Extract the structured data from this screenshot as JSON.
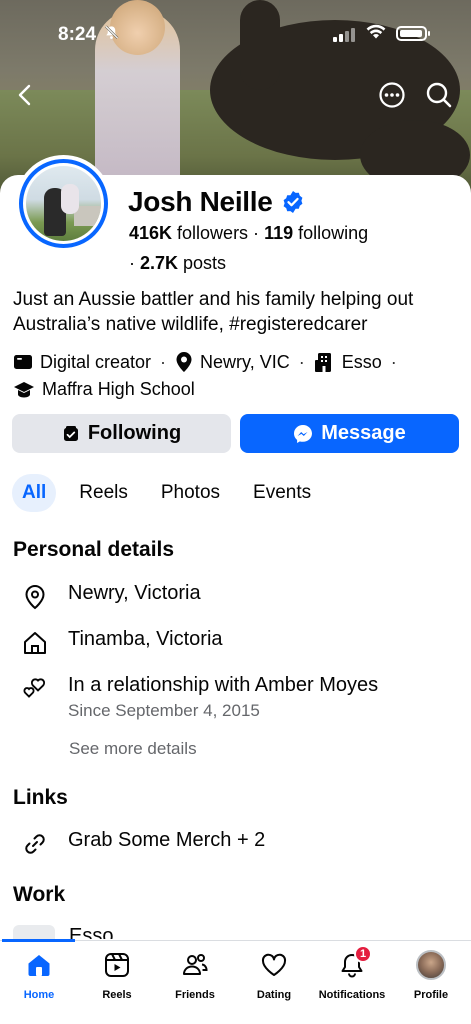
{
  "status_bar": {
    "time": "8:24"
  },
  "profile": {
    "name": "Josh Neille",
    "followers_count": "416K",
    "followers_label": " followers · ",
    "following_count": "119",
    "following_label": " following",
    "posts_prefix": "· ",
    "posts_count": "2.7K",
    "posts_label": " posts",
    "bio": "Just an Aussie battler and his family helping out Australia’s native wildlife, #registeredcarer"
  },
  "meta": {
    "category": "Digital creator",
    "location": "Newry, VIC",
    "workplace": "Esso",
    "school": "Maffra High School"
  },
  "buttons": {
    "following": "Following",
    "message": "Message"
  },
  "tabs": [
    "All",
    "Reels",
    "Photos",
    "Events"
  ],
  "personal_details": {
    "title": "Personal details",
    "current_city": "Newry, Victoria",
    "hometown": "Tinamba, Victoria",
    "relationship": "In a relationship with Amber Moyes",
    "relationship_since": "Since September 4, 2015",
    "see_more": "See more details"
  },
  "links": {
    "title": "Links",
    "item": "Grab Some Merch + 2"
  },
  "work": {
    "title": "Work",
    "item": "Esso"
  },
  "bottom_nav": {
    "home": "Home",
    "reels": "Reels",
    "friends": "Friends",
    "dating": "Dating",
    "notifications": "Notifications",
    "notifications_badge": "1",
    "profile": "Profile"
  },
  "colors": {
    "accent": "#0866ff",
    "badge": "#e41e3f",
    "secondary_text": "#65676b"
  }
}
